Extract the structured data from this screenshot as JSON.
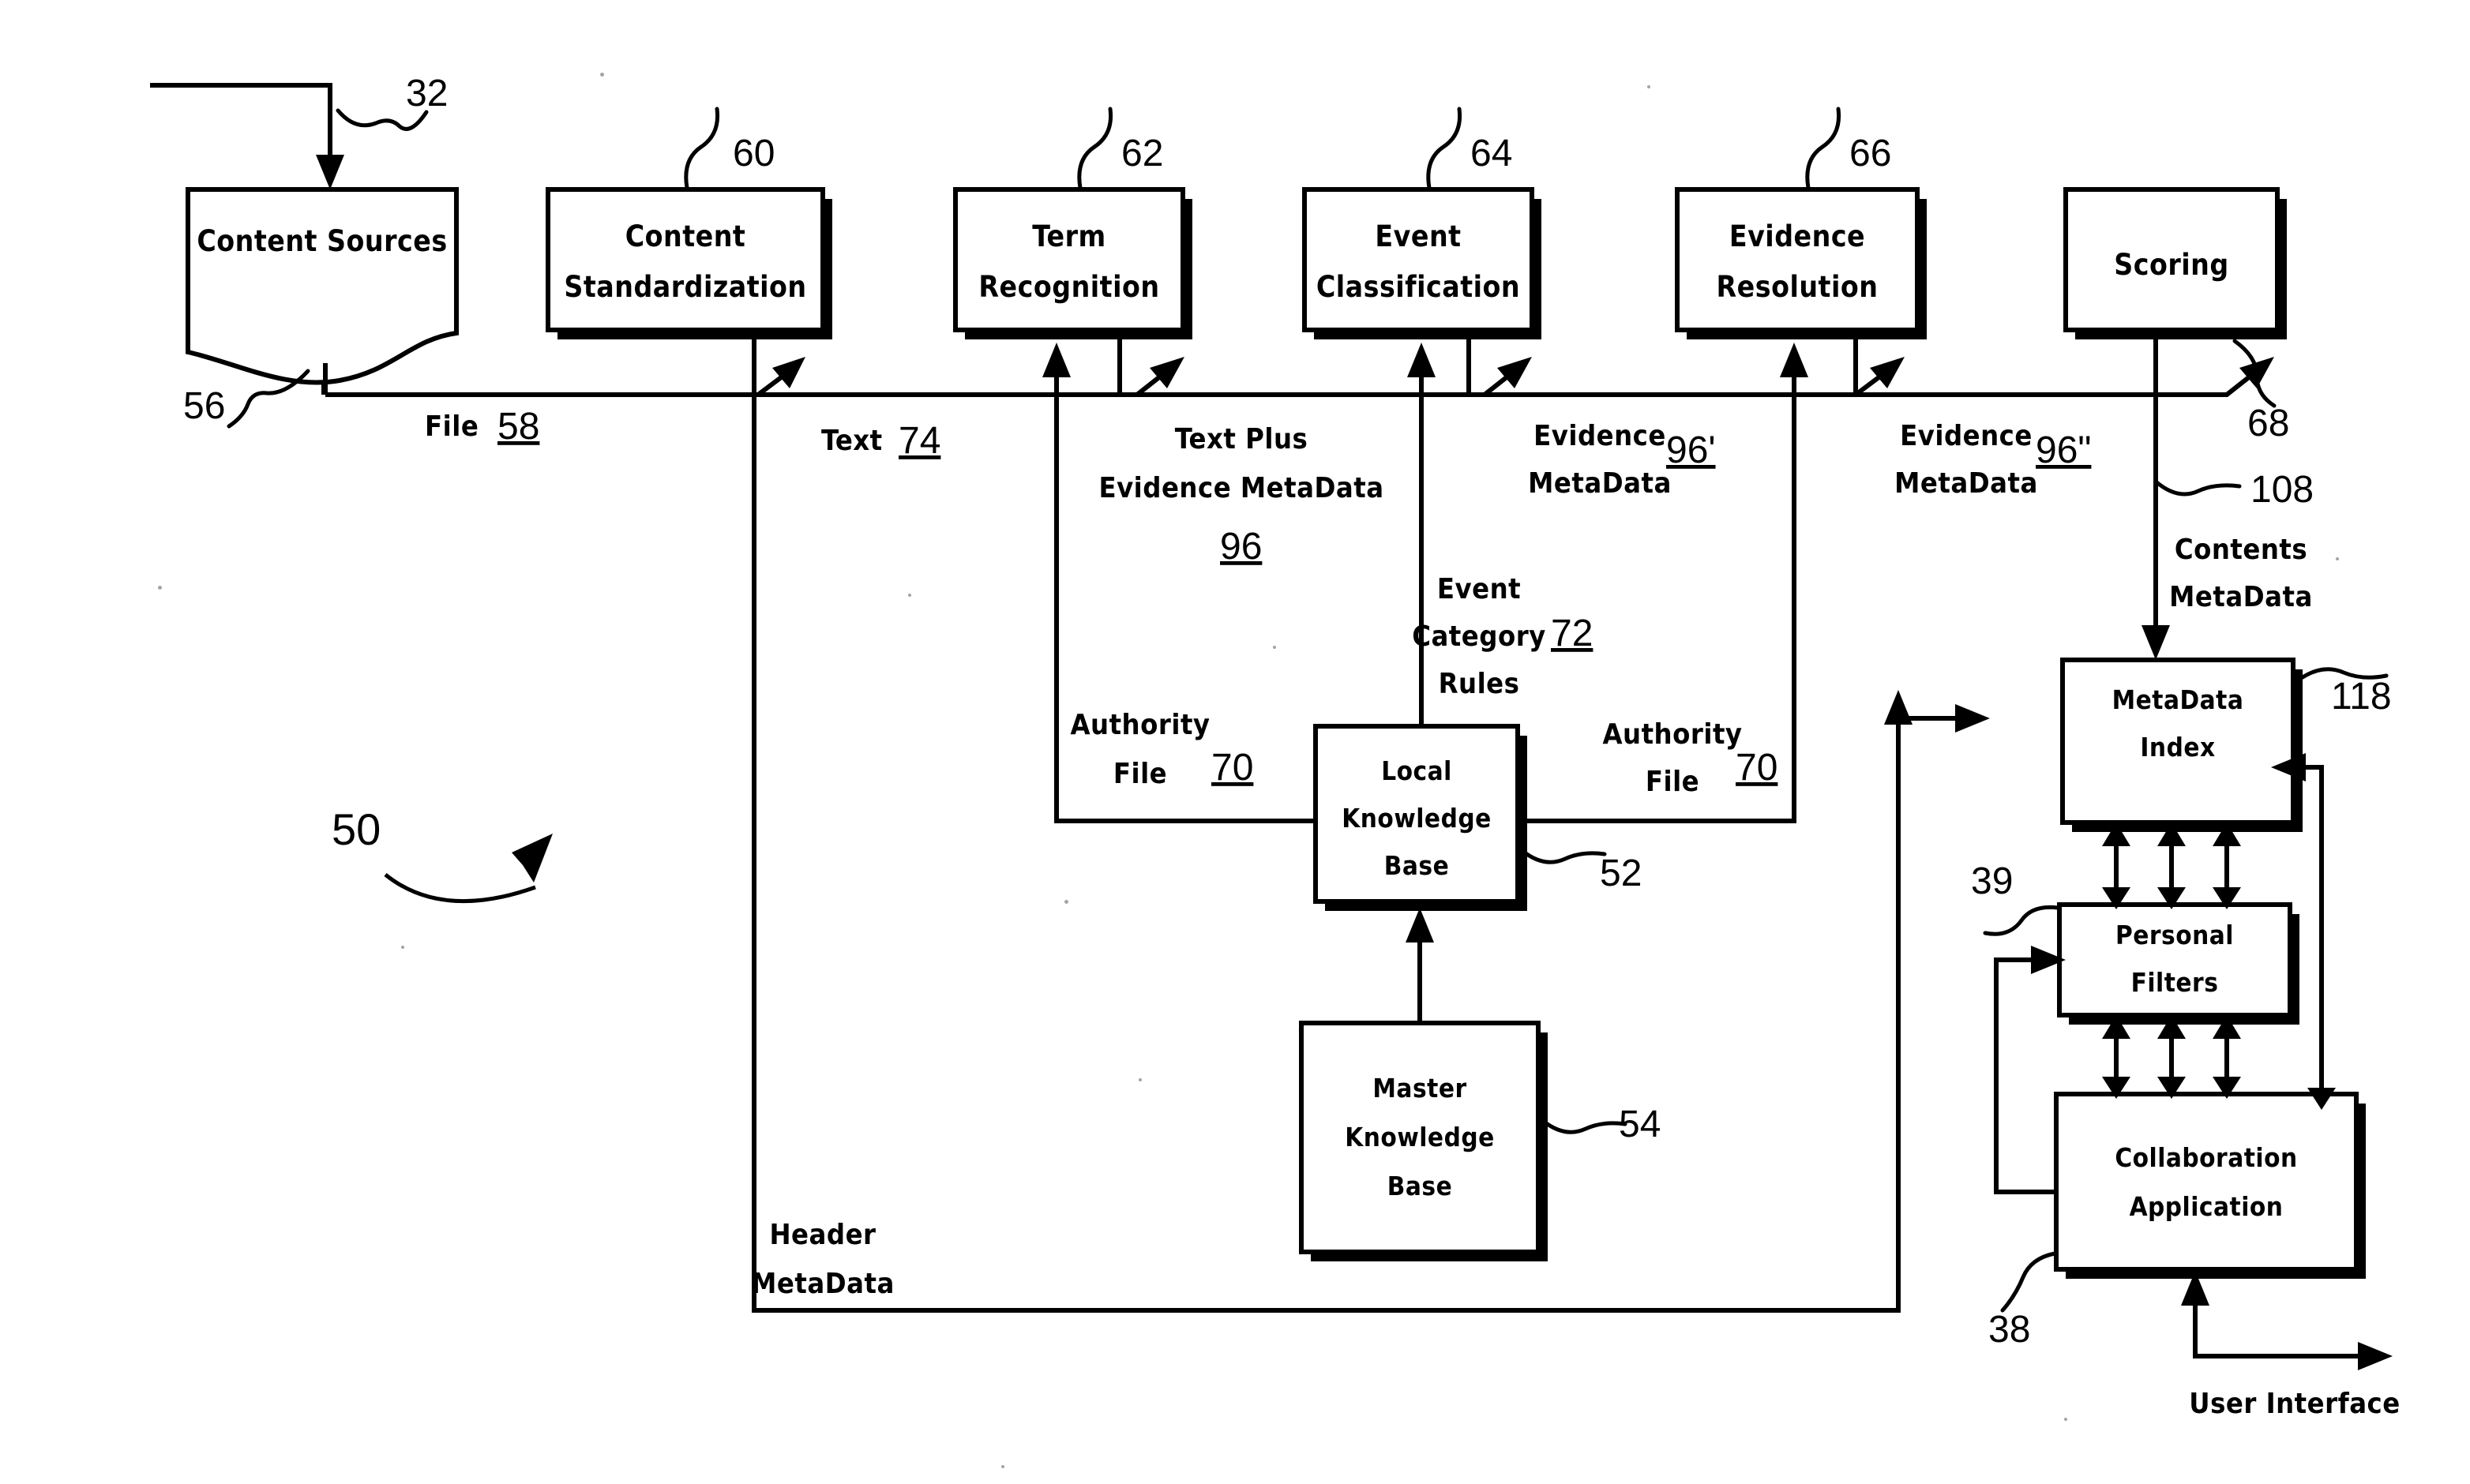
{
  "figure": {
    "title": "Content processing and collaboration system flow diagram",
    "system_ref": "50"
  },
  "boxes": {
    "content_sources": {
      "label_line1": "Content Sources",
      "ref": "56"
    },
    "content_standardization": {
      "label_line1": "Content",
      "label_line2": "Standardization",
      "ref": "60"
    },
    "term_recognition": {
      "label_line1": "Term",
      "label_line2": "Recognition",
      "ref": "62"
    },
    "event_classification": {
      "label_line1": "Event",
      "label_line2": "Classification",
      "ref": "64"
    },
    "evidence_resolution": {
      "label_line1": "Evidence",
      "label_line2": "Resolution",
      "ref": "66"
    },
    "scoring": {
      "label_line1": "Scoring",
      "ref": "68"
    },
    "local_knowledge_base": {
      "label_line1": "Local",
      "label_line2": "Knowledge",
      "label_line3": "Base",
      "ref": "52"
    },
    "master_knowledge_base": {
      "label_line1": "Master",
      "label_line2": "Knowledge",
      "label_line3": "Base",
      "ref": "54"
    },
    "metadata_index": {
      "label_line1": "MetaData",
      "label_line2": "Index",
      "ref": "118"
    },
    "personal_filters": {
      "label_line1": "Personal",
      "label_line2": "Filters",
      "ref": "39"
    },
    "collaboration_application": {
      "label_line1": "Collaboration",
      "label_line2": "Application",
      "ref": "38"
    }
  },
  "flow_labels": {
    "input_ref": "32",
    "file": {
      "text": "File",
      "ref": "58"
    },
    "text": {
      "text": "Text",
      "ref": "74"
    },
    "text_plus_evidence_metadata": {
      "line1": "Text Plus",
      "line2": "Evidence MetaData",
      "ref": "96"
    },
    "evidence_metadata_1": {
      "line1": "Evidence",
      "line2": "MetaData",
      "ref": "96'"
    },
    "evidence_metadata_2": {
      "line1": "Evidence",
      "line2": "MetaData",
      "ref": "96\""
    },
    "authority_file_left": {
      "line1": "Authority",
      "line2": "File",
      "ref": "70"
    },
    "authority_file_right": {
      "line1": "Authority",
      "line2": "File",
      "ref": "70"
    },
    "event_category_rules": {
      "line1": "Event",
      "line2": "Category",
      "line3": "Rules",
      "ref": "72"
    },
    "contents_metadata": {
      "line1": "Contents",
      "line2": "MetaData",
      "ref": "108"
    },
    "header_metadata": {
      "line1": "Header",
      "line2": "MetaData"
    },
    "user_interface": {
      "text": "User Interface"
    }
  }
}
